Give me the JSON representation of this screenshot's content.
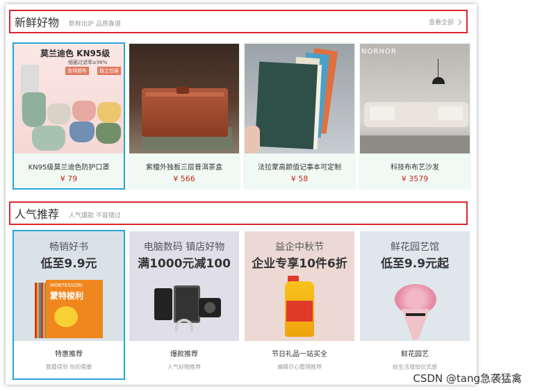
{
  "sections": {
    "fresh": {
      "title": "新鲜好物",
      "subtitle": "新鲜出炉 品质靠谱",
      "more": "查看全部",
      "products": [
        {
          "name": "KN95级莫兰迪色防护口罩",
          "price": "¥ 79",
          "img_line1": "莫兰迪色 KN95级",
          "img_line2": "细菌过滤率≥98%",
          "img_tag1": "含排烟布",
          "img_tag2": "独立包装"
        },
        {
          "name": "紫檀外独板三层普洱茶盒",
          "price": "¥ 566"
        },
        {
          "name": "法拉蒙高颜值记事本可定制",
          "price": "¥ 58"
        },
        {
          "name": "科技布布艺沙发",
          "price": "¥ 3579",
          "img_brand": "NORHOR"
        }
      ]
    },
    "popular": {
      "title": "人气推荐",
      "subtitle": "人气爆款 不容错过",
      "items": [
        {
          "name": "特惠推荐",
          "sub": "我猜得到 你的需要",
          "banner1": "畅销好书",
          "banner2": "低至9.9元",
          "book_text1": "MONTESSORI",
          "book_text2": "蒙特梭利"
        },
        {
          "name": "爆款推荐",
          "sub": "人气好物推荐",
          "banner1": "电脑数码 镇店好物",
          "banner2": "满1000元减100"
        },
        {
          "name": "节日礼品一站买全",
          "sub": "编辑尽心整理推荐",
          "banner1": "益企中秋节",
          "banner2": "企业专享10件6折"
        },
        {
          "name": "鲜花园艺",
          "sub": "给生活增加仪式感",
          "banner1": "鲜花园艺馆",
          "banner2": "低至9.9元起"
        }
      ]
    }
  },
  "watermark": "CSDN @tang急袭猛禽",
  "colors": {
    "section_border": "#d9262f",
    "highlight_border": "#27a4d8",
    "price": "#c52a1a"
  }
}
